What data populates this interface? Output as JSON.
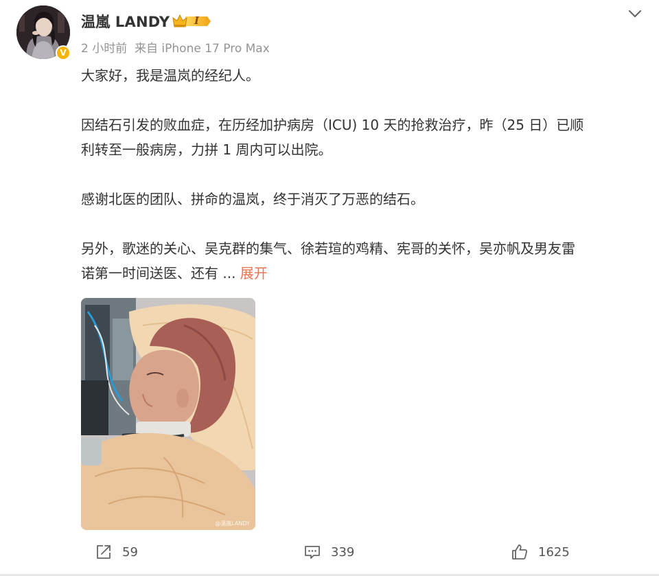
{
  "post": {
    "author": {
      "name": "温嵐 LANDY",
      "vip_level": "I",
      "verified_mark": "V"
    },
    "meta": "2 小时前  来自 iPhone 17 Pro Max",
    "paragraphs": [
      [
        "大家好，我是温岚的经纪人。"
      ],
      [
        "因结石引发的败血症，在历经加护病房（ICU) 10 天的抢救治疗，昨（25 日）已顺",
        "利转至一般病房，力拼 1 周内可以出院。"
      ],
      [
        "感谢北医的团队、拼命的温岚，终于消灭了万恶的结石。"
      ],
      [
        "另外，歌迷的关心、吴克群的集气、徐若瑄的鸡精、宪哥的关怀，吴亦帆及男友雷",
        "诺第一时间送医、还有 ..."
      ]
    ],
    "expand_label": "展开",
    "photo_watermark": "@温嵐LANDY",
    "actions": {
      "repost_count": "59",
      "comment_count": "339",
      "like_count": "1625"
    }
  },
  "icons": {
    "more": "chevron-down-icon",
    "repost": "repost-icon",
    "comment": "comment-icon",
    "like": "thumbs-up-icon",
    "verified": "verified-badge-icon",
    "vip": "crown-icon"
  },
  "colors": {
    "accent_link": "#eb7350",
    "meta_text": "#939393",
    "body_text": "#333333",
    "verified_badge": "#f5b400"
  }
}
